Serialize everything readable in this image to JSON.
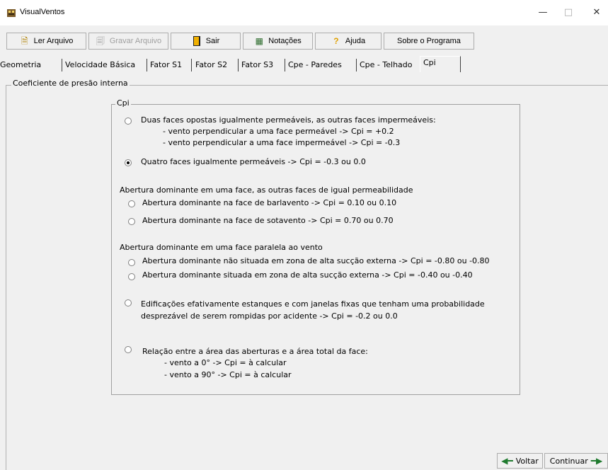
{
  "window": {
    "title": "VisualVentos",
    "controls": [
      "—",
      "□",
      "✕"
    ]
  },
  "toolbar": [
    {
      "label": "Ler Arquivo",
      "icon": "open-file-icon",
      "enabled": true
    },
    {
      "label": "Gravar Arquivo",
      "icon": "save-file-icon",
      "enabled": false
    },
    {
      "label": "Sair",
      "icon": "exit-door-icon",
      "enabled": true
    },
    {
      "label": "Notações",
      "icon": "notes-icon",
      "enabled": true
    },
    {
      "label": "Ajuda",
      "icon": "help-icon",
      "enabled": true
    },
    {
      "label": "Sobre o Programa",
      "icon": "",
      "enabled": true
    }
  ],
  "tabs": [
    "Geometria",
    "Velocidade Básica",
    "Fator S1",
    "Fator S2",
    "Fator S3",
    "Cpe - Paredes",
    "Cpe - Telhado",
    "Cpi"
  ],
  "active_tab": "Cpi",
  "group_title": "Coeficiente de presão interna",
  "cpi_group_title": "Cpi",
  "options": {
    "opt1": "Duas faces opostas igualmente permeáveis, as outras faces impermeáveis:",
    "opt1_sub1": "- vento perpendicular a uma face permeável -> Cpi = +0.2",
    "opt1_sub2": "- vento perpendicular a uma face impermeável -> Cpi = -0.3",
    "opt2": "Quatro faces igualmente permeáveis -> Cpi = -0.3 ou 0.0",
    "section_a": "Abertura dominante em uma face, as outras faces de igual permeabilidade",
    "opt3": "Abertura dominante na face de barlavento -> Cpi = 0.10   ou 0.10",
    "opt4": "Abertura dominante na face de sotavento -> Cpi = 0.70   ou 0.70",
    "section_b": "Abertura dominante em uma face paralela ao vento",
    "opt5": "Abertura dominante não situada em zona de alta sucção externa -> Cpi = -0.80 ou -0.80",
    "opt6": "Abertura dominante situada em zona de alta sucção externa -> Cpi = -0.40 ou -0.40",
    "opt7_line1": "Edificações efativamente estanques e com janelas fixas que tenham uma probabilidade",
    "opt7_line2": "desprezável de serem rompidas por acidente -> Cpi = -0.2 ou 0.0",
    "opt8": "Relação entre a área das aberturas e a área total da face:",
    "opt8_sub1": "- vento a 0° -> Cpi = à calcular",
    "opt8_sub2": "- vento a 90° -> Cpi = à calcular"
  },
  "selected_option": "opt2",
  "nav": {
    "back": "Voltar",
    "next": "Continuar"
  }
}
